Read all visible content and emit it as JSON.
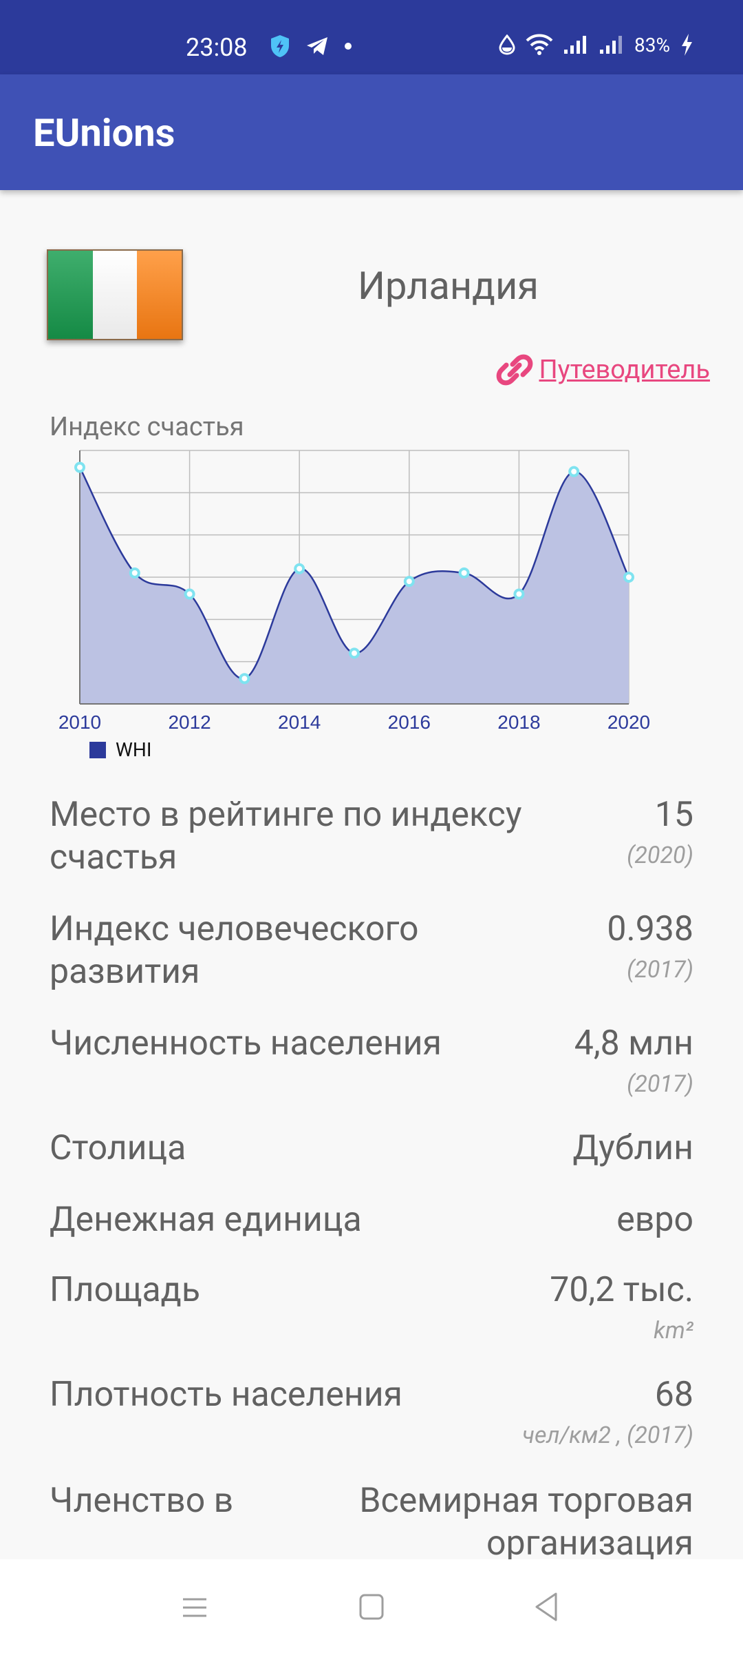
{
  "status": {
    "time": "23:08",
    "battery": "83%"
  },
  "app": {
    "title": "EUnions"
  },
  "country": {
    "name": "Ирландия",
    "flag_colors": [
      "#169b62",
      "#ffffff",
      "#ff883e"
    ],
    "guide_link": "Путеводитель"
  },
  "chart_title": "Индекс счастья",
  "chart_data": {
    "type": "area",
    "x": [
      2010,
      2011,
      2012,
      2013,
      2014,
      2015,
      2016,
      2017,
      2018,
      2019,
      2020
    ],
    "tick_labels": [
      "2010",
      "2012",
      "2014",
      "2016",
      "2018",
      "2020"
    ],
    "series": [
      {
        "name": "WHI",
        "values": [
          7.26,
          7.01,
          6.96,
          6.76,
          7.02,
          6.82,
          6.99,
          7.01,
          6.96,
          7.25,
          7.0
        ],
        "line_color": "#2c3a9b",
        "fill_color": "#bcc2e3",
        "point_color": "#7fe3f0"
      }
    ],
    "ylim": [
      6.7,
      7.3
    ],
    "grid": true,
    "legend": "bottom-left"
  },
  "facts": [
    {
      "label": "Место в рейтинге по индексу счастья",
      "value": "15",
      "sub": "(2020)"
    },
    {
      "label": "Индекс человеческого развития",
      "value": "0.938",
      "sub": "(2017)"
    },
    {
      "label": "Численность населения",
      "value": "4,8 млн",
      "sub": "(2017)"
    },
    {
      "label": "Столица",
      "value": "Дублин",
      "sub": ""
    },
    {
      "label": "Денежная единица",
      "value": "евро",
      "sub": ""
    },
    {
      "label": "Площадь",
      "value": "70,2 тыс.",
      "sub": "km²"
    },
    {
      "label": "Плотность населения",
      "value": "68",
      "sub": "чел/км2 , (2017)"
    },
    {
      "label": "Членство в",
      "value": "Всемирная торговая организация",
      "sub": ""
    }
  ]
}
